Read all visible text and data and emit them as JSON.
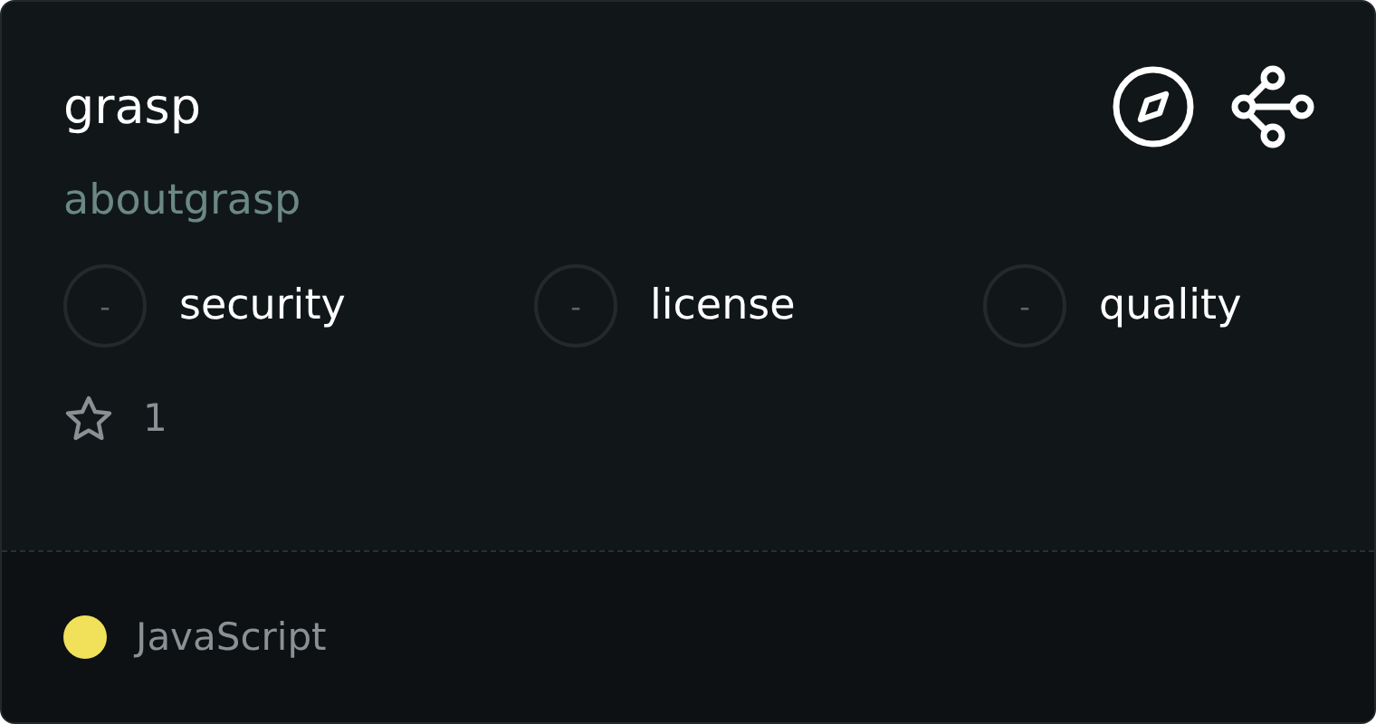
{
  "card": {
    "title": "grasp",
    "subtitle": "aboutgrasp",
    "scores": [
      {
        "value": "-",
        "label": "security"
      },
      {
        "value": "-",
        "label": "license"
      },
      {
        "value": "-",
        "label": "quality"
      }
    ],
    "stars": "1",
    "language": {
      "name": "JavaScript",
      "color": "#f1e05a"
    }
  }
}
